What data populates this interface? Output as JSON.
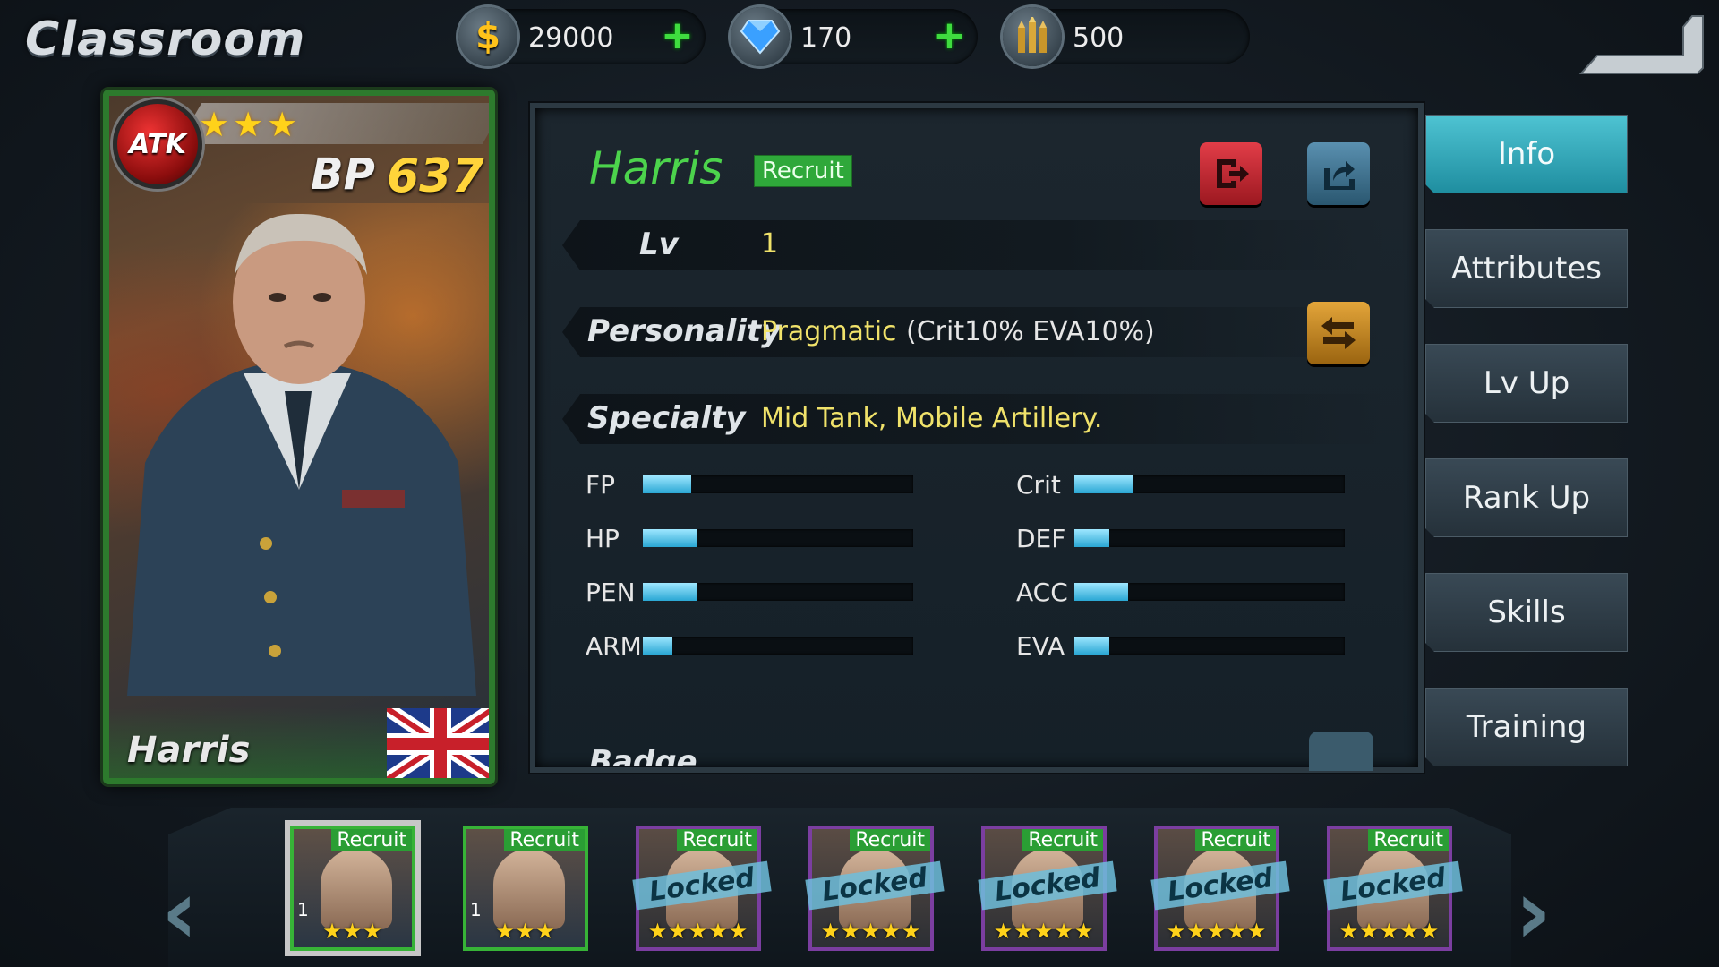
{
  "header": {
    "title": "Classroom",
    "currencies": [
      {
        "name": "gold",
        "icon": "dollar-coin-icon",
        "value": "29000",
        "has_plus": true
      },
      {
        "name": "gems",
        "icon": "diamond-icon",
        "value": "170",
        "has_plus": true
      },
      {
        "name": "ammo",
        "icon": "ammo-icon",
        "value": "500",
        "has_plus": false
      }
    ]
  },
  "card": {
    "type_badge": "ATK",
    "stars": "★★★",
    "bp_label": "BP",
    "bp_value": "637",
    "name": "Harris"
  },
  "info": {
    "name": "Harris",
    "rank_badge": "Recruit",
    "level_label": "Lv",
    "level_value": "1",
    "personality_label": "Personality",
    "personality_value": "Pragmatic",
    "personality_note": "(Crit10%  EVA10%)",
    "specialty_label": "Specialty",
    "specialty_value": "Mid Tank, Mobile Artillery.",
    "stats_left": [
      {
        "label": "FP",
        "fill": 0.18
      },
      {
        "label": "HP",
        "fill": 0.2
      },
      {
        "label": "PEN",
        "fill": 0.2
      },
      {
        "label": "ARM",
        "fill": 0.11
      }
    ],
    "stats_right": [
      {
        "label": "Crit",
        "fill": 0.22
      },
      {
        "label": "DEF",
        "fill": 0.13
      },
      {
        "label": "ACC",
        "fill": 0.2
      },
      {
        "label": "EVA",
        "fill": 0.13
      }
    ],
    "badge_label": "Badge"
  },
  "menu": [
    "Info",
    "Attributes",
    "Lv Up",
    "Rank Up",
    "Skills",
    "Training"
  ],
  "roster": [
    {
      "badge": "Recruit",
      "level": "1",
      "stars": "★★★",
      "locked": false,
      "frame": "green",
      "selected": true
    },
    {
      "badge": "Recruit",
      "level": "1",
      "stars": "★★★",
      "locked": false,
      "frame": "green",
      "selected": false
    },
    {
      "badge": "Recruit",
      "level": "",
      "stars": "★★★★★",
      "locked": true,
      "frame": "purple",
      "selected": false
    },
    {
      "badge": "Recruit",
      "level": "",
      "stars": "★★★★★",
      "locked": true,
      "frame": "purple",
      "selected": false
    },
    {
      "badge": "Recruit",
      "level": "",
      "stars": "★★★★★",
      "locked": true,
      "frame": "purple",
      "selected": false
    },
    {
      "badge": "Recruit",
      "level": "",
      "stars": "★★★★★",
      "locked": true,
      "frame": "purple",
      "selected": false
    },
    {
      "badge": "Recruit",
      "level": "",
      "stars": "★★★★★",
      "locked": true,
      "frame": "purple",
      "selected": false
    }
  ],
  "locked_label": "Locked",
  "colors": {
    "accent": "#4ec3d2",
    "name_green": "#4cd34c",
    "stat_fill": "#2aa7d4",
    "gold": "#ffd43a"
  }
}
